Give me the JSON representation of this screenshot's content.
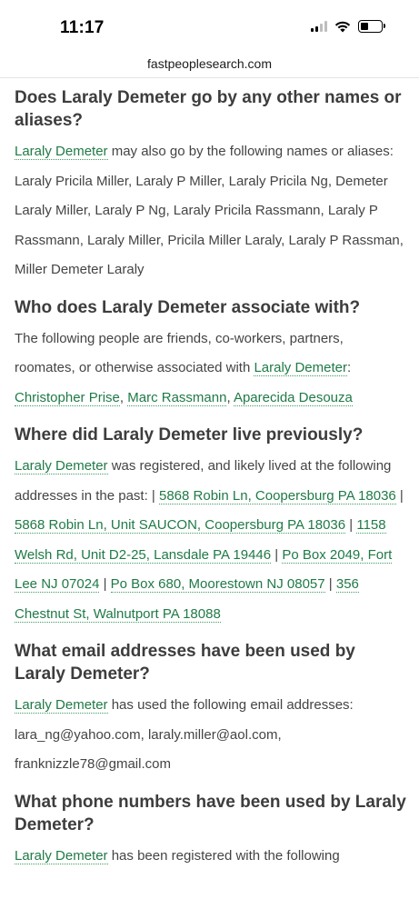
{
  "status": {
    "time": "11:17"
  },
  "browser": {
    "url": "fastpeoplesearch.com"
  },
  "sections": {
    "aliases": {
      "heading": "Does Laraly Demeter go by any other names or aliases?",
      "name_link": "Laraly Demeter",
      "text": " may also go by the following names or aliases: Laraly Pricila Miller, Laraly P Miller, Laraly Pricila Ng, Demeter Laraly Miller, Laraly P Ng, Laraly Pricila Rassmann, Laraly P Rassmann, Laraly Miller, Pricila Miller Laraly, Laraly P Rassman, Miller Demeter Laraly"
    },
    "associates": {
      "heading": "Who does Laraly Demeter associate with?",
      "text": "The following people are friends, co-workers, partners, roomates, or otherwise associated with ",
      "name_link": "Laraly Demeter",
      "colon": ":",
      "people": [
        "Christopher Prise",
        "Marc Rassmann",
        "Aparecida Desouza"
      ]
    },
    "addresses": {
      "heading": "Where did Laraly Demeter live previously?",
      "name_link": "Laraly Demeter",
      "text": " was registered, and likely lived at the following addresses in the past: | ",
      "list": [
        "5868 Robin Ln, Coopersburg PA 18036",
        "5868 Robin Ln, Unit SAUCON, Coopersburg PA 18036",
        "1158 Welsh Rd, Unit D2-25, Lansdale PA 19446",
        "Po Box 2049, Fort Lee NJ 07024",
        "Po Box 680, Moorestown NJ 08057",
        "356 Chestnut St, Walnutport PA 18088"
      ]
    },
    "emails": {
      "heading": "What email addresses have been used by Laraly Demeter?",
      "name_link": "Laraly Demeter",
      "text": " has used the following email addresses: lara_ng@yahoo.com, laraly.miller@aol.com, franknizzle78@gmail.com"
    },
    "phones": {
      "heading": "What phone numbers have been used by Laraly Demeter?",
      "name_link": "Laraly Demeter",
      "text": " has been registered with the following"
    }
  }
}
